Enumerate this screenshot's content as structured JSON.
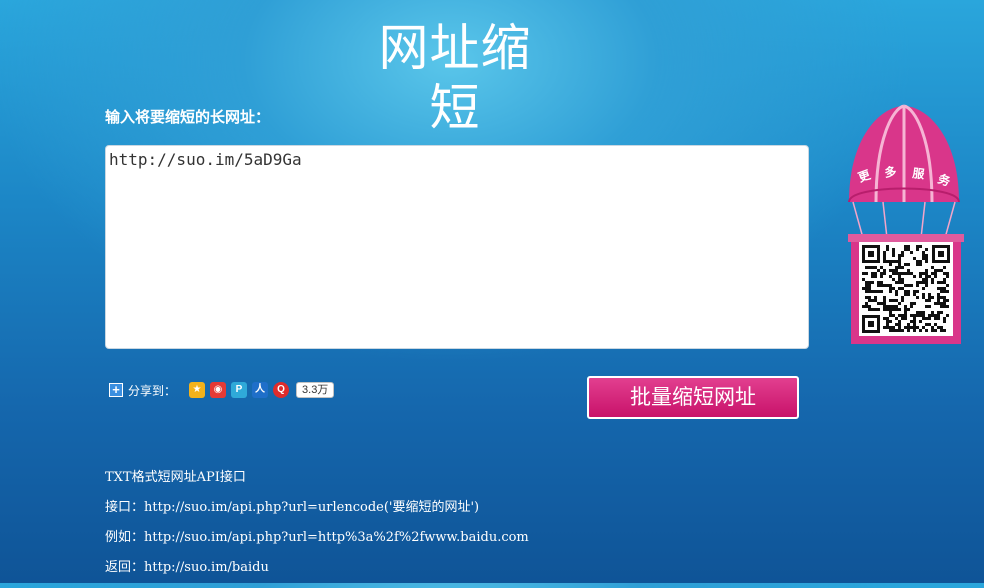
{
  "header": {
    "title": "网址缩短"
  },
  "form": {
    "prompt": "输入将要缩短的长网址：",
    "url_value": "http://suo.im/5aD9Ga"
  },
  "share": {
    "label": "分享到：",
    "icons": [
      "qzone-icon",
      "weibo-icon",
      "tencent-weibo-icon",
      "renren-icon",
      "douban-icon"
    ],
    "count": "3.3万"
  },
  "actions": {
    "batch_label": "批量缩短网址"
  },
  "promo": {
    "label_chars": [
      "更",
      "多",
      "服",
      "务"
    ],
    "accent_color": "#d9368a"
  },
  "api": {
    "heading": "TXT格式短网址API接口",
    "interface": "接口：http://suo.im/api.php?url=urlencode('要缩短的网址')",
    "example": "例如：http://suo.im/api.php?url=http%3a%2f%2fwww.baidu.com",
    "returns": "返回：http://suo.im/baidu"
  }
}
